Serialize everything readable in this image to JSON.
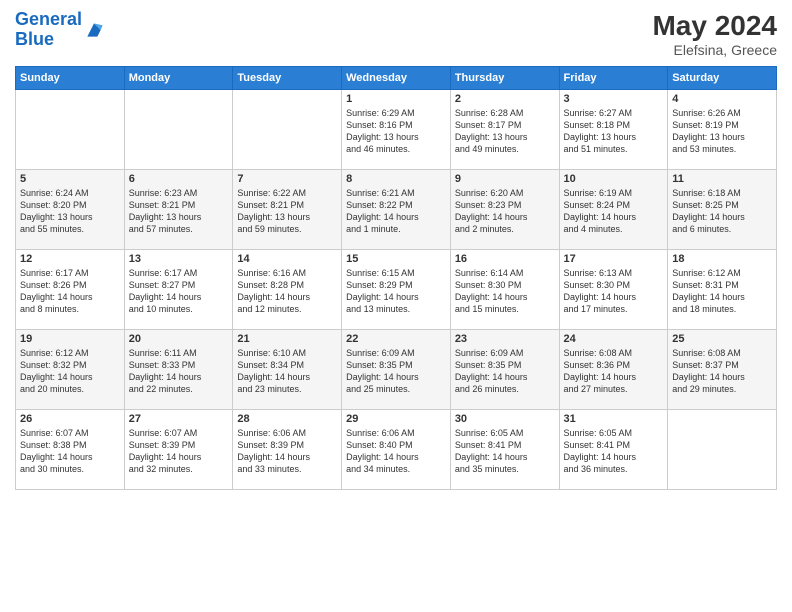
{
  "header": {
    "logo_line1": "General",
    "logo_line2": "Blue",
    "month_year": "May 2024",
    "location": "Elefsina, Greece"
  },
  "weekdays": [
    "Sunday",
    "Monday",
    "Tuesday",
    "Wednesday",
    "Thursday",
    "Friday",
    "Saturday"
  ],
  "weeks": [
    [
      {
        "day": "",
        "info": ""
      },
      {
        "day": "",
        "info": ""
      },
      {
        "day": "",
        "info": ""
      },
      {
        "day": "1",
        "info": "Sunrise: 6:29 AM\nSunset: 8:16 PM\nDaylight: 13 hours\nand 46 minutes."
      },
      {
        "day": "2",
        "info": "Sunrise: 6:28 AM\nSunset: 8:17 PM\nDaylight: 13 hours\nand 49 minutes."
      },
      {
        "day": "3",
        "info": "Sunrise: 6:27 AM\nSunset: 8:18 PM\nDaylight: 13 hours\nand 51 minutes."
      },
      {
        "day": "4",
        "info": "Sunrise: 6:26 AM\nSunset: 8:19 PM\nDaylight: 13 hours\nand 53 minutes."
      }
    ],
    [
      {
        "day": "5",
        "info": "Sunrise: 6:24 AM\nSunset: 8:20 PM\nDaylight: 13 hours\nand 55 minutes."
      },
      {
        "day": "6",
        "info": "Sunrise: 6:23 AM\nSunset: 8:21 PM\nDaylight: 13 hours\nand 57 minutes."
      },
      {
        "day": "7",
        "info": "Sunrise: 6:22 AM\nSunset: 8:21 PM\nDaylight: 13 hours\nand 59 minutes."
      },
      {
        "day": "8",
        "info": "Sunrise: 6:21 AM\nSunset: 8:22 PM\nDaylight: 14 hours\nand 1 minute."
      },
      {
        "day": "9",
        "info": "Sunrise: 6:20 AM\nSunset: 8:23 PM\nDaylight: 14 hours\nand 2 minutes."
      },
      {
        "day": "10",
        "info": "Sunrise: 6:19 AM\nSunset: 8:24 PM\nDaylight: 14 hours\nand 4 minutes."
      },
      {
        "day": "11",
        "info": "Sunrise: 6:18 AM\nSunset: 8:25 PM\nDaylight: 14 hours\nand 6 minutes."
      }
    ],
    [
      {
        "day": "12",
        "info": "Sunrise: 6:17 AM\nSunset: 8:26 PM\nDaylight: 14 hours\nand 8 minutes."
      },
      {
        "day": "13",
        "info": "Sunrise: 6:17 AM\nSunset: 8:27 PM\nDaylight: 14 hours\nand 10 minutes."
      },
      {
        "day": "14",
        "info": "Sunrise: 6:16 AM\nSunset: 8:28 PM\nDaylight: 14 hours\nand 12 minutes."
      },
      {
        "day": "15",
        "info": "Sunrise: 6:15 AM\nSunset: 8:29 PM\nDaylight: 14 hours\nand 13 minutes."
      },
      {
        "day": "16",
        "info": "Sunrise: 6:14 AM\nSunset: 8:30 PM\nDaylight: 14 hours\nand 15 minutes."
      },
      {
        "day": "17",
        "info": "Sunrise: 6:13 AM\nSunset: 8:30 PM\nDaylight: 14 hours\nand 17 minutes."
      },
      {
        "day": "18",
        "info": "Sunrise: 6:12 AM\nSunset: 8:31 PM\nDaylight: 14 hours\nand 18 minutes."
      }
    ],
    [
      {
        "day": "19",
        "info": "Sunrise: 6:12 AM\nSunset: 8:32 PM\nDaylight: 14 hours\nand 20 minutes."
      },
      {
        "day": "20",
        "info": "Sunrise: 6:11 AM\nSunset: 8:33 PM\nDaylight: 14 hours\nand 22 minutes."
      },
      {
        "day": "21",
        "info": "Sunrise: 6:10 AM\nSunset: 8:34 PM\nDaylight: 14 hours\nand 23 minutes."
      },
      {
        "day": "22",
        "info": "Sunrise: 6:09 AM\nSunset: 8:35 PM\nDaylight: 14 hours\nand 25 minutes."
      },
      {
        "day": "23",
        "info": "Sunrise: 6:09 AM\nSunset: 8:35 PM\nDaylight: 14 hours\nand 26 minutes."
      },
      {
        "day": "24",
        "info": "Sunrise: 6:08 AM\nSunset: 8:36 PM\nDaylight: 14 hours\nand 27 minutes."
      },
      {
        "day": "25",
        "info": "Sunrise: 6:08 AM\nSunset: 8:37 PM\nDaylight: 14 hours\nand 29 minutes."
      }
    ],
    [
      {
        "day": "26",
        "info": "Sunrise: 6:07 AM\nSunset: 8:38 PM\nDaylight: 14 hours\nand 30 minutes."
      },
      {
        "day": "27",
        "info": "Sunrise: 6:07 AM\nSunset: 8:39 PM\nDaylight: 14 hours\nand 32 minutes."
      },
      {
        "day": "28",
        "info": "Sunrise: 6:06 AM\nSunset: 8:39 PM\nDaylight: 14 hours\nand 33 minutes."
      },
      {
        "day": "29",
        "info": "Sunrise: 6:06 AM\nSunset: 8:40 PM\nDaylight: 14 hours\nand 34 minutes."
      },
      {
        "day": "30",
        "info": "Sunrise: 6:05 AM\nSunset: 8:41 PM\nDaylight: 14 hours\nand 35 minutes."
      },
      {
        "day": "31",
        "info": "Sunrise: 6:05 AM\nSunset: 8:41 PM\nDaylight: 14 hours\nand 36 minutes."
      },
      {
        "day": "",
        "info": ""
      }
    ]
  ]
}
